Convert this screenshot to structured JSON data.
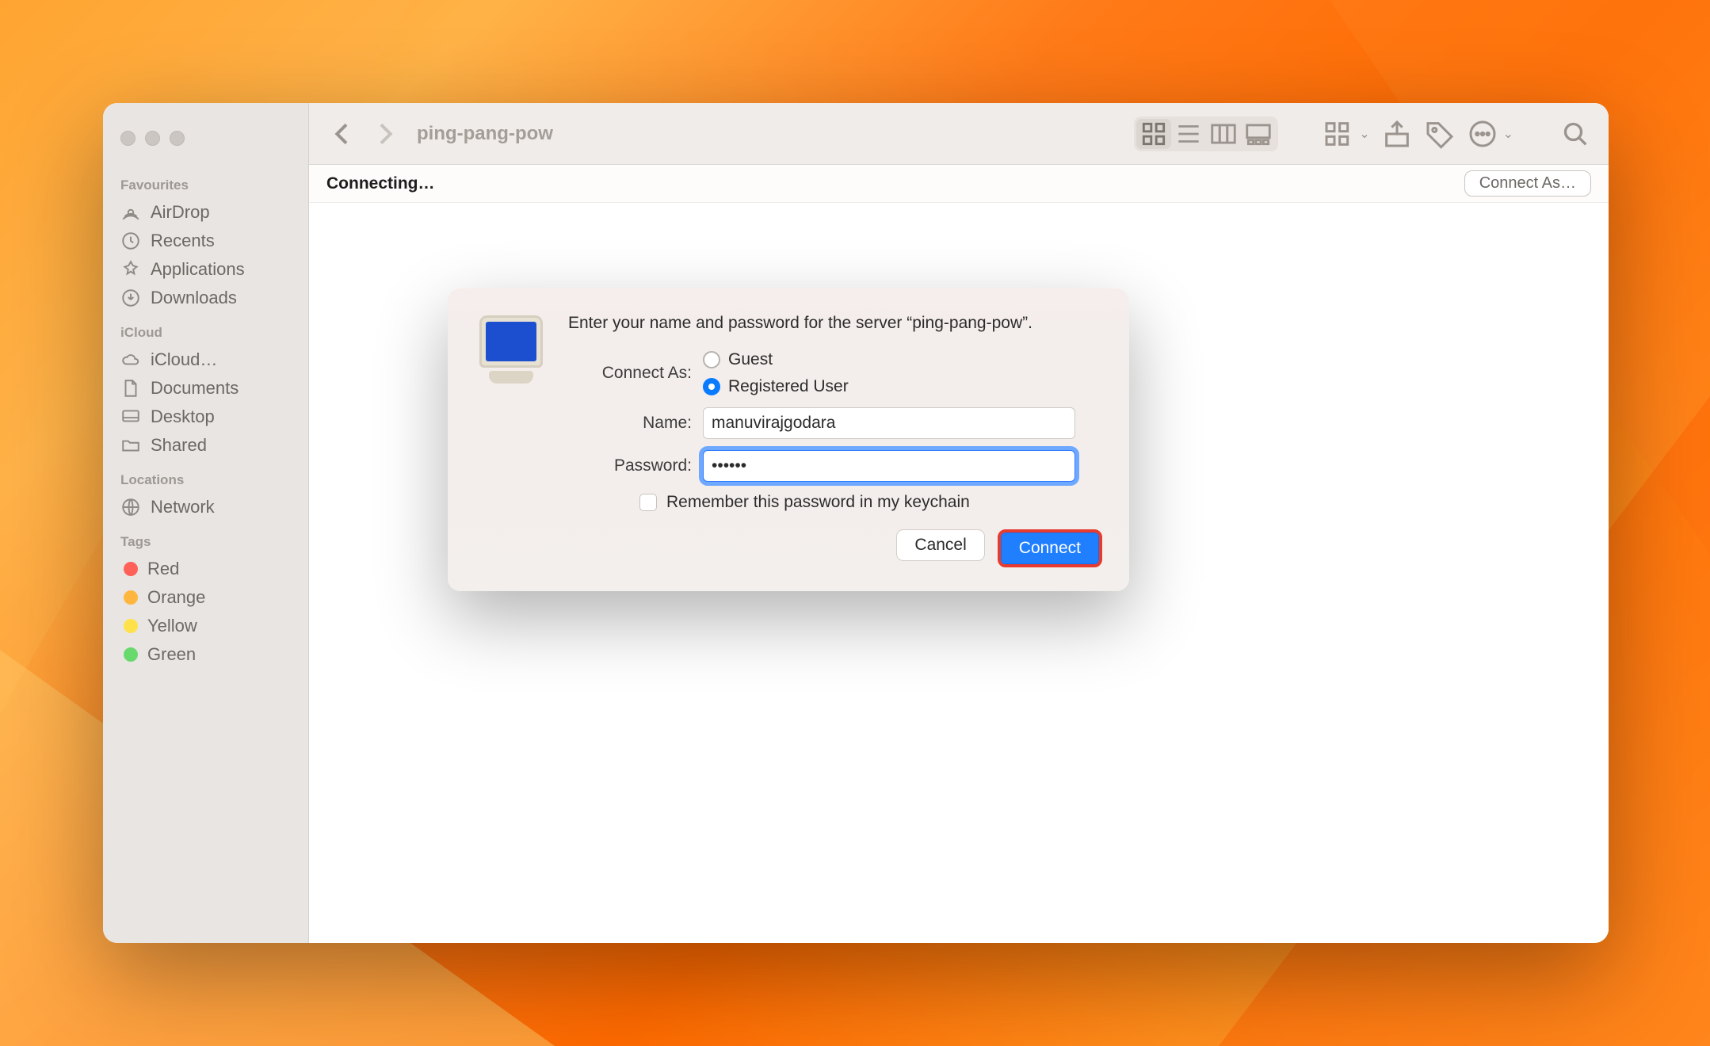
{
  "window": {
    "title": "ping-pang-pow"
  },
  "status": {
    "text": "Connecting…",
    "connect_as_label": "Connect As…"
  },
  "sidebar": {
    "sections": {
      "favourites": {
        "label": "Favourites",
        "items": [
          "AirDrop",
          "Recents",
          "Applications",
          "Downloads"
        ]
      },
      "icloud": {
        "label": "iCloud",
        "items": [
          "iCloud…",
          "Documents",
          "Desktop",
          "Shared"
        ]
      },
      "locations": {
        "label": "Locations",
        "items": [
          "Network"
        ]
      },
      "tags": {
        "label": "Tags",
        "items": [
          "Red",
          "Orange",
          "Yellow",
          "Green"
        ]
      }
    }
  },
  "dialog": {
    "message": "Enter your name and password for the server “ping-pang-pow”.",
    "connect_as_label": "Connect As:",
    "guest_label": "Guest",
    "registered_label": "Registered User",
    "selected": "registered",
    "name_label": "Name:",
    "name_value": "manuvirajgodara",
    "password_label": "Password:",
    "password_value": "••••••",
    "remember_label": "Remember this password in my keychain",
    "remember_checked": false,
    "cancel_label": "Cancel",
    "connect_label": "Connect"
  }
}
